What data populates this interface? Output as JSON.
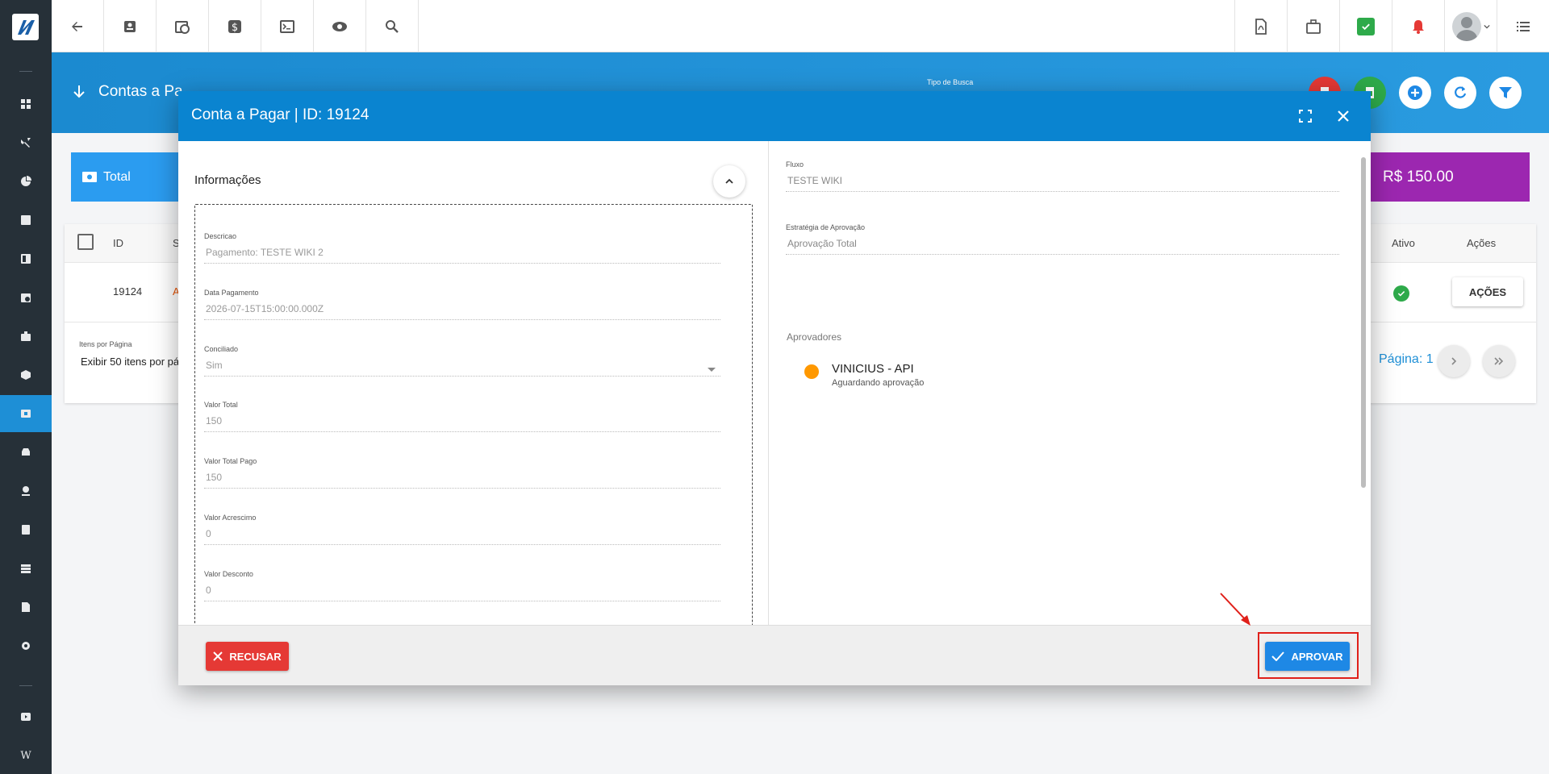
{
  "topbar": {
    "icons": [
      "back-arrow-icon",
      "contact-card-icon",
      "clock-calendar-icon",
      "dollar-icon",
      "terminal-icon",
      "eye-icon",
      "search-icon",
      "pdf-icon",
      "briefcase-icon",
      "check-message-icon",
      "bell-icon",
      "avatar",
      "list-icon"
    ]
  },
  "banner": {
    "title": "Contas a Pa",
    "tipo_busca": "Tipo de Busca"
  },
  "cards": {
    "total_label": "Total",
    "purple_value": "R$ 150.00"
  },
  "table": {
    "headers": {
      "id": "ID",
      "s": "S",
      "ativo": "Ativo",
      "acoes": "Ações"
    },
    "rows": [
      {
        "id": "19124",
        "status_short": "A",
        "acoes_label": "AÇÕES"
      }
    ],
    "items_label": "Itens por Página",
    "items_value": "Exibir 50 itens por pá",
    "page_label": "Página: 1"
  },
  "modal": {
    "title": "Conta a Pagar | ID: 19124",
    "section_title": "Informações",
    "fields": [
      {
        "label": "Descricao",
        "value": "Pagamento: TESTE WIKI 2"
      },
      {
        "label": "Data Pagamento",
        "value": "2026-07-15T15:00:00.000Z"
      },
      {
        "label": "Conciliado",
        "value": "Sim"
      },
      {
        "label": "Valor Total",
        "value": "150"
      },
      {
        "label": "Valor Total Pago",
        "value": "150"
      },
      {
        "label": "Valor Acrescimo",
        "value": "0"
      },
      {
        "label": "Valor Desconto",
        "value": "0"
      }
    ],
    "right": {
      "fluxo_label": "Fluxo",
      "fluxo_value": "TESTE WIKI",
      "estrategia_label": "Estratégia de Aprovação",
      "estrategia_value": "Aprovação Total",
      "aprovadores_label": "Aprovadores",
      "approver_name": "VINICIUS - API",
      "approver_status": "Aguardando aprovação"
    },
    "footer": {
      "recusar_label": "RECUSAR",
      "aprovar_label": "APROVAR"
    }
  },
  "colors": {
    "primary": "#0a84d0",
    "danger": "#e53935",
    "approve": "#1e88e5",
    "pending": "#ff9800",
    "purple": "#9c27b0"
  }
}
